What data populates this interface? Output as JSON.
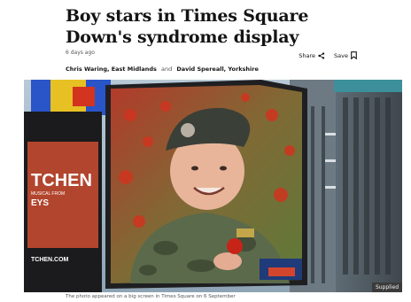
{
  "article": {
    "headline": "Boy stars in Times Square Down's syndrome display",
    "timestamp": "6 days ago",
    "share_label": "Share",
    "save_label": "Save",
    "authors": [
      {
        "name": "Chris Waring, East Midlands"
      },
      {
        "name": "David Spereall, Yorkshire"
      }
    ],
    "author_separator": "and"
  },
  "image": {
    "credit": "Supplied",
    "caption": "The photo appeared on a big screen in Times Square on 6 September",
    "billboard_text_1": "TCHEN",
    "billboard_text_2": "MUSICAL FROM",
    "billboard_text_3": "EYS",
    "billboard_url": "TCHEN.COM"
  }
}
